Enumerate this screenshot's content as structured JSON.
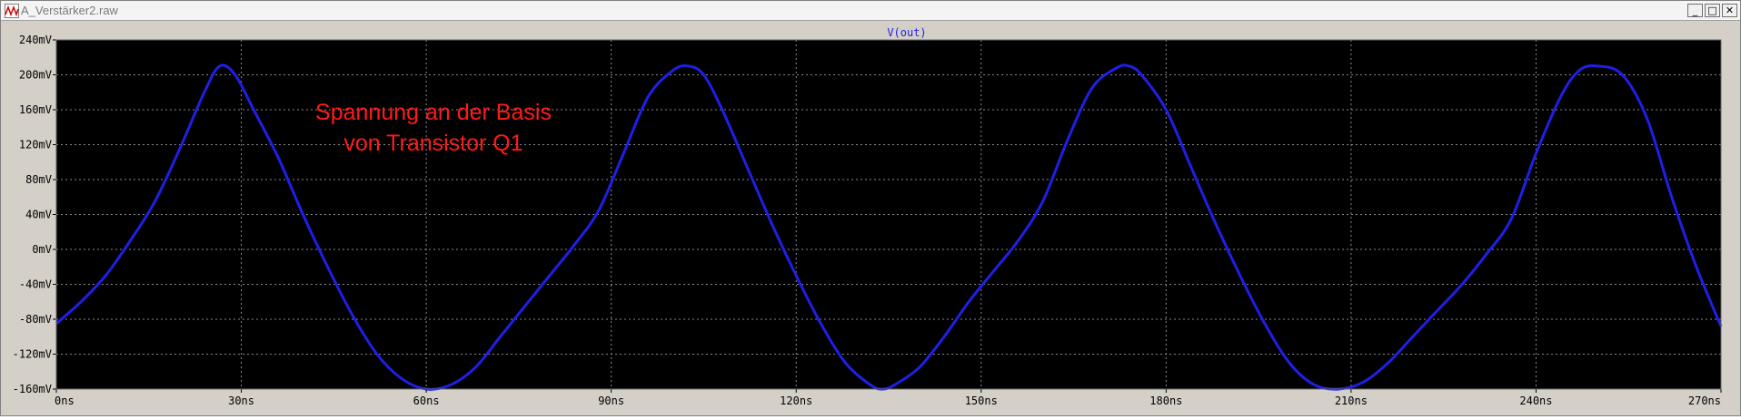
{
  "window": {
    "title": "A_Verstärker2.raw",
    "buttons": {
      "minimize": "_",
      "maximize": "□",
      "close": "✕"
    }
  },
  "colors": {
    "trace": "#1f1fe6",
    "annotation": "#ff1a1a",
    "plot_background": "#000000",
    "grid": "#8a8a8a",
    "axis_label": "#000000"
  },
  "annotation": {
    "line1": "Spannung an der Basis",
    "line2": "von Transistor Q1"
  },
  "chart_data": {
    "type": "line",
    "xlabel": "",
    "ylabel": "",
    "x_unit": "ns",
    "y_unit": "mV",
    "xlim": [
      0,
      270
    ],
    "ylim": [
      -160,
      240
    ],
    "grid": true,
    "x_tick_labels": [
      "0ns",
      "30ns",
      "60ns",
      "90ns",
      "120ns",
      "150ns",
      "180ns",
      "210ns",
      "240ns",
      "270ns"
    ],
    "y_tick_labels": [
      "240mV",
      "200mV",
      "160mV",
      "120mV",
      "80mV",
      "40mV",
      "0mV",
      "-40mV",
      "-80mV",
      "-120mV",
      "-160mV"
    ],
    "series": [
      {
        "name": "V(out)",
        "x": [
          0,
          4,
          8,
          12,
          16,
          20,
          24,
          26.5,
          29,
          32,
          36,
          40,
          44,
          48,
          52,
          56,
          60,
          64,
          68,
          72,
          76,
          80,
          84,
          88,
          92,
          96,
          100,
          102.5,
          105,
          108,
          112,
          116,
          120,
          124,
          128,
          132,
          134,
          136,
          140,
          144,
          148,
          152,
          156,
          160,
          164,
          168,
          172,
          174,
          176,
          180,
          184,
          188,
          192,
          196,
          200,
          204,
          208,
          212,
          216,
          220,
          224,
          228,
          232,
          236,
          240,
          244,
          247,
          250,
          254,
          258,
          262,
          266,
          270
        ],
        "y": [
          -85,
          -60,
          -30,
          10,
          55,
          115,
          180,
          210,
          200,
          160,
          105,
          40,
          -20,
          -75,
          -120,
          -148,
          -160,
          -155,
          -135,
          -100,
          -65,
          -30,
          5,
          45,
          110,
          175,
          205,
          210,
          200,
          160,
          95,
          30,
          -30,
          -85,
          -130,
          -155,
          -160,
          -155,
          -135,
          -100,
          -60,
          -25,
          10,
          55,
          125,
          185,
          208,
          210,
          200,
          160,
          95,
          30,
          -30,
          -85,
          -130,
          -155,
          -160,
          -152,
          -130,
          -100,
          -70,
          -40,
          -5,
          35,
          110,
          175,
          205,
          210,
          200,
          150,
          60,
          -20,
          -88
        ]
      }
    ]
  }
}
